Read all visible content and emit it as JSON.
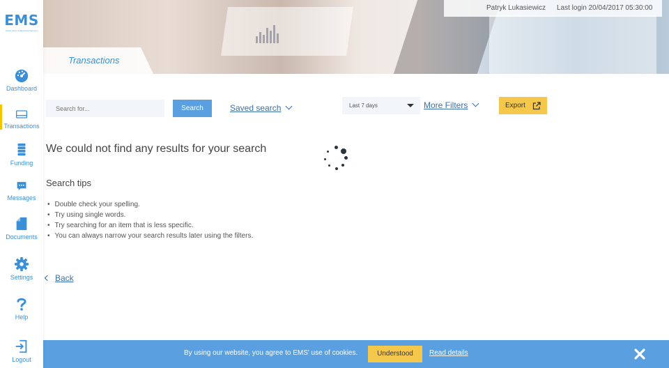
{
  "brand": {
    "logo_text": "EMS",
    "logo_sub": "Online Store & Merchants Services"
  },
  "sidebar": {
    "items": [
      {
        "label": "Dashboard",
        "icon": "dashboard-gauge-icon"
      },
      {
        "label": "Transactions",
        "icon": "card-icon"
      },
      {
        "label": "Funding",
        "icon": "coins-icon"
      },
      {
        "label": "Messages",
        "icon": "chat-icon"
      },
      {
        "label": "Documents",
        "icon": "document-icon"
      },
      {
        "label": "Settings",
        "icon": "gear-icon"
      },
      {
        "label": "Help",
        "icon": "question-icon"
      },
      {
        "label": "Logout",
        "icon": "logout-icon"
      }
    ],
    "active": "Transactions",
    "accent": "#f5c400"
  },
  "header": {
    "user_name": "Patryk Lukasiewicz",
    "last_login_label": "Last login 20/04/2017 05:30:00",
    "page_title": "Transactions"
  },
  "toolbar": {
    "search_placeholder": "Search for...",
    "search_button": "Search",
    "saved_search": "Saved search",
    "date_range": "Last 7 days",
    "more_filters": "More Filters",
    "export": "Export"
  },
  "results": {
    "empty_message": "We could not find any results for your search",
    "tips_title": "Search tips",
    "tips": [
      "Double check your spelling.",
      "Try using single words.",
      "Try searching for an item that is less specific.",
      "You can always narrow your search results later using the filters."
    ],
    "back": "Back"
  },
  "cookie": {
    "message": "By using our website, you agree to EMS' use of cookies.",
    "understood": "Understood",
    "read_details": "Read details"
  },
  "colors": {
    "primary_blue": "#5aa0e0",
    "link_blue": "#3a6fa8",
    "accent_yellow": "#f5c84b"
  }
}
